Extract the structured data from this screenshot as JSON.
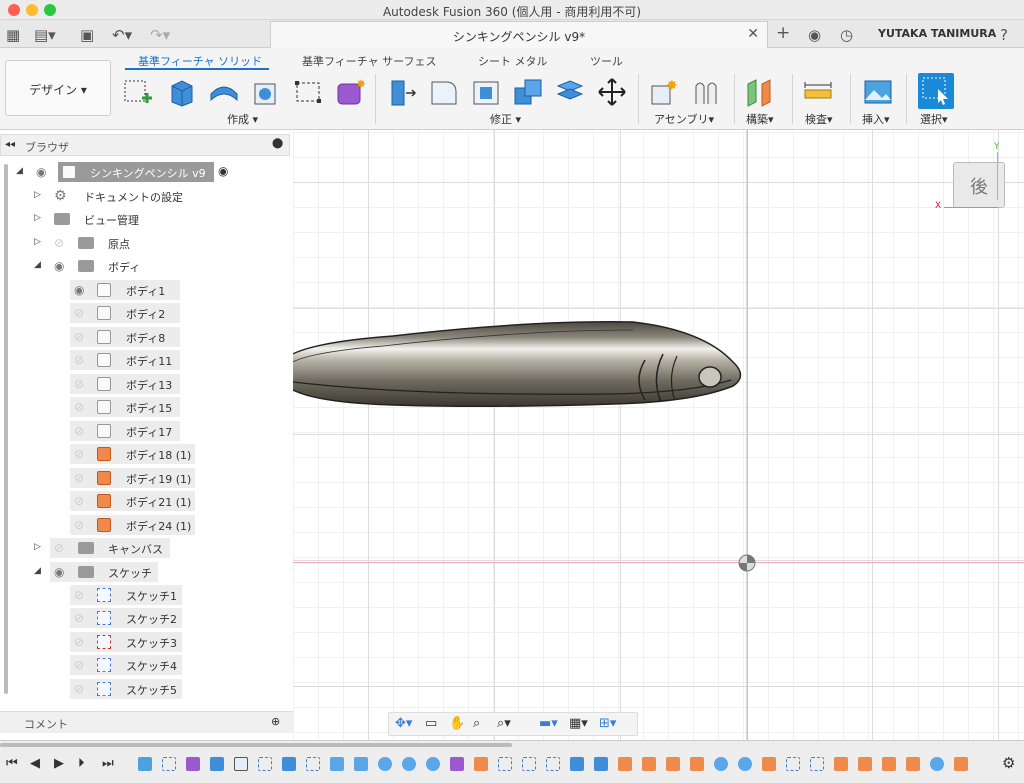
{
  "window": {
    "title": "Autodesk Fusion 360 (個人用 - 商用利用不可)"
  },
  "tabbar": {
    "document_tab": "シンキングペンシル v9*",
    "user": "YUTAKA TANIMURA"
  },
  "ribbon": {
    "workspace": "デザイン",
    "tabs": [
      "基準フィーチャ ソリッド",
      "基準フィーチャ サーフェス",
      "シート メタル",
      "ツール"
    ],
    "groups": [
      "作成",
      "修正",
      "アセンブリ",
      "構築",
      "検査",
      "挿入",
      "選択"
    ]
  },
  "browser": {
    "title": "ブラウザ",
    "root": "シンキングペンシル v9",
    "items": [
      {
        "label": "ドキュメントの設定"
      },
      {
        "label": "ビュー管理"
      },
      {
        "label": "原点"
      },
      {
        "label": "ボディ"
      }
    ],
    "bodies": [
      "ボディ1",
      "ボディ2",
      "ボディ8",
      "ボディ11",
      "ボディ13",
      "ボディ15",
      "ボディ17",
      "ボディ18 (1)",
      "ボディ19 (1)",
      "ボディ21 (1)",
      "ボディ24 (1)"
    ],
    "canvas_folder": "キャンバス",
    "sketch_folder": "スケッチ",
    "sketches": [
      "スケッチ1",
      "スケッチ2",
      "スケッチ3",
      "スケッチ4",
      "スケッチ5"
    ]
  },
  "comment": {
    "label": "コメント"
  },
  "viewcube": {
    "face": "後",
    "axis_x": "X",
    "axis_y": "Y"
  },
  "colors": {
    "accent": "#1a73c8",
    "body_shade": "#6e6a5f",
    "x_axis": "#e07a8a",
    "y_axis": "#7fd07f"
  }
}
